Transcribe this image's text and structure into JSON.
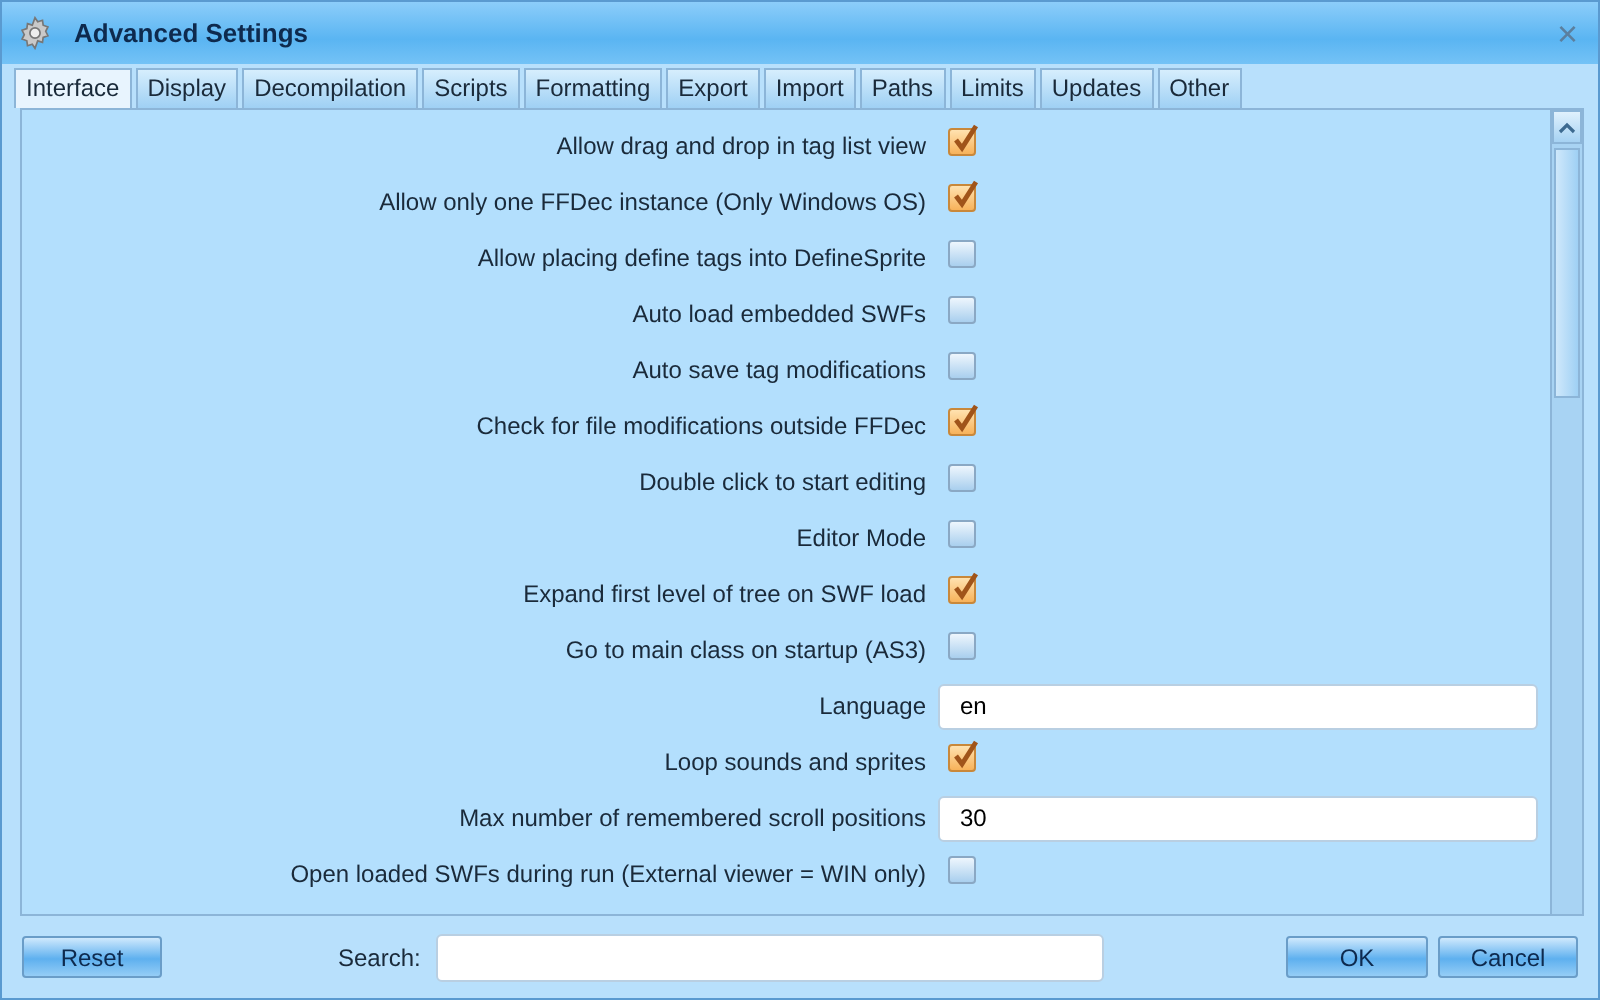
{
  "window": {
    "title": "Advanced Settings",
    "close": "×"
  },
  "tabs": [
    {
      "label": "Interface",
      "selected": true
    },
    {
      "label": "Display",
      "selected": false
    },
    {
      "label": "Decompilation",
      "selected": false
    },
    {
      "label": "Scripts",
      "selected": false
    },
    {
      "label": "Formatting",
      "selected": false
    },
    {
      "label": "Export",
      "selected": false
    },
    {
      "label": "Import",
      "selected": false
    },
    {
      "label": "Paths",
      "selected": false
    },
    {
      "label": "Limits",
      "selected": false
    },
    {
      "label": "Updates",
      "selected": false
    },
    {
      "label": "Other",
      "selected": false
    }
  ],
  "settings": [
    {
      "kind": "checkbox",
      "label": "Allow drag and drop in tag list view",
      "checked": true
    },
    {
      "kind": "checkbox",
      "label": "Allow only one FFDec instance (Only Windows OS)",
      "checked": true
    },
    {
      "kind": "checkbox",
      "label": "Allow placing define tags into DefineSprite",
      "checked": false
    },
    {
      "kind": "checkbox",
      "label": "Auto load embedded SWFs",
      "checked": false
    },
    {
      "kind": "checkbox",
      "label": "Auto save tag modifications",
      "checked": false
    },
    {
      "kind": "checkbox",
      "label": "Check for file modifications outside FFDec",
      "checked": true
    },
    {
      "kind": "checkbox",
      "label": "Double click to start editing",
      "checked": false
    },
    {
      "kind": "checkbox",
      "label": "Editor Mode",
      "checked": false
    },
    {
      "kind": "checkbox",
      "label": "Expand first level of tree on SWF load",
      "checked": true
    },
    {
      "kind": "checkbox",
      "label": "Go to main class on startup (AS3)",
      "checked": false
    },
    {
      "kind": "text",
      "label": "Language",
      "value": "en"
    },
    {
      "kind": "checkbox",
      "label": "Loop sounds and sprites",
      "checked": true
    },
    {
      "kind": "text",
      "label": "Max number of remembered scroll positions",
      "value": "30"
    },
    {
      "kind": "checkbox",
      "label": "Open loaded SWFs during run (External viewer = WIN only)",
      "checked": false
    }
  ],
  "footer": {
    "reset": "Reset",
    "search_label": "Search:",
    "ok": "OK",
    "cancel": "Cancel"
  }
}
